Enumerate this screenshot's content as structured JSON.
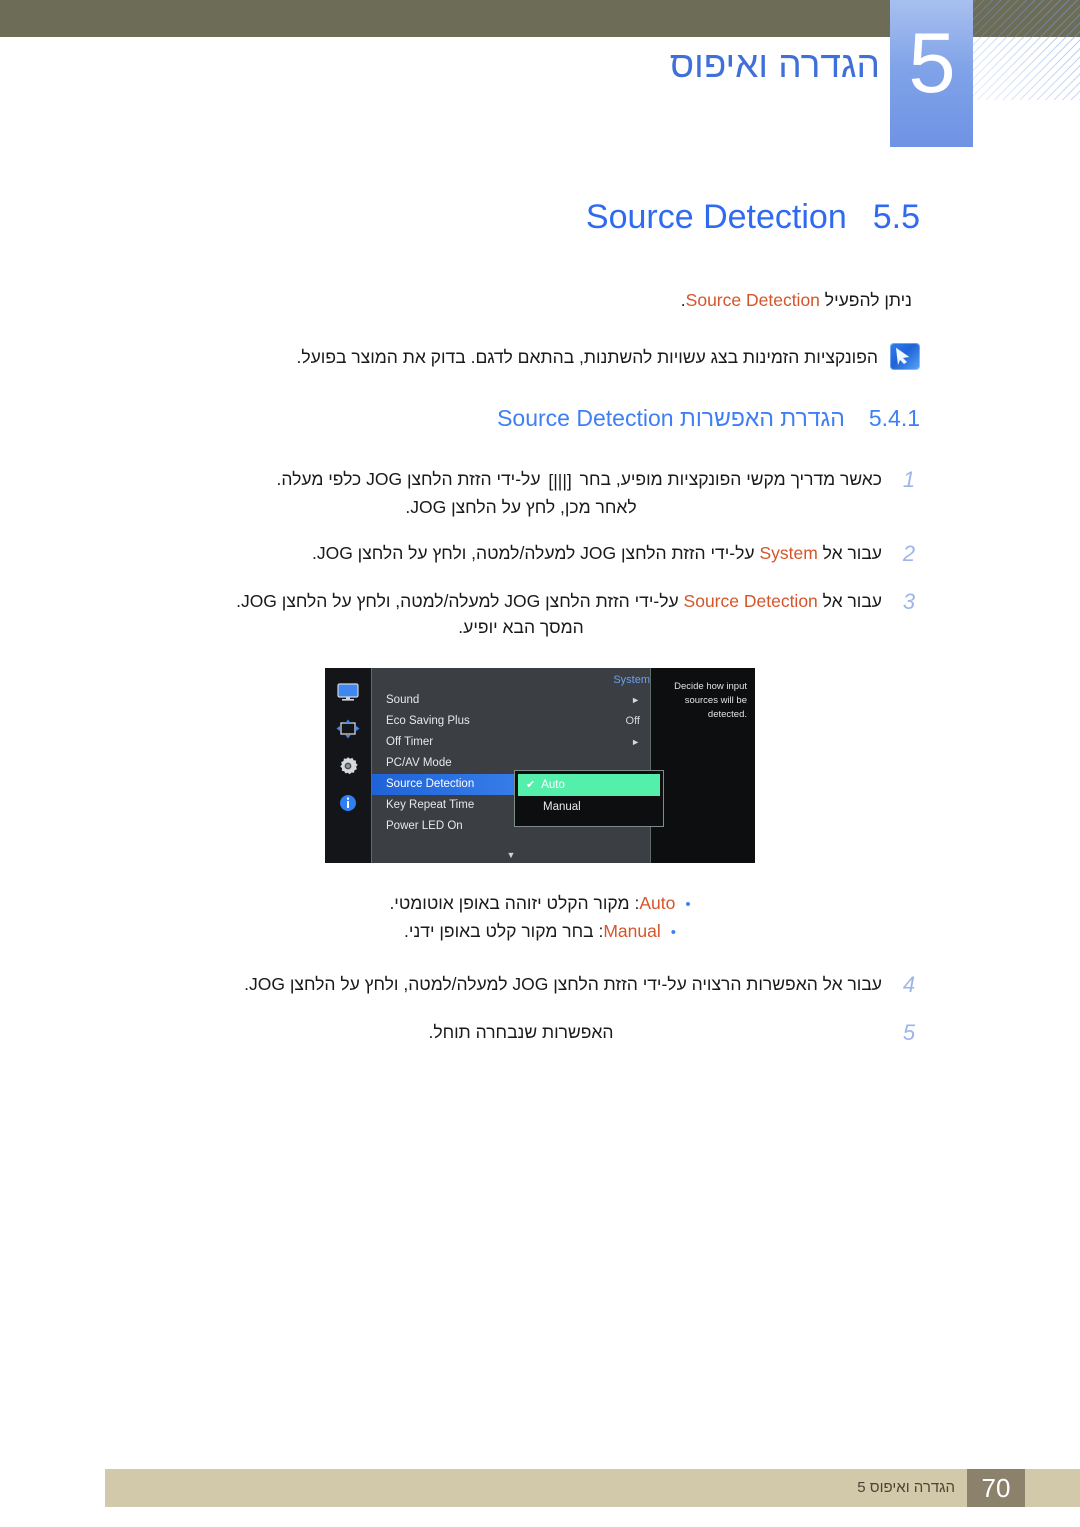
{
  "header": {
    "chapter_number": "5",
    "chapter_title": "הגדרה ואיפוס"
  },
  "section": {
    "number": "5.5",
    "title": "Source Detection",
    "lead_prefix": "ניתן להפעיל",
    "lead_term": "Source Detection",
    "lead_suffix": "."
  },
  "note": {
    "icon": "note-pen-icon",
    "text": "הפונקציות הזמינות בצג עשויות להשתנות, בהתאם לדגם. בדוק את המוצר בפועל."
  },
  "subsection": {
    "number": "5.4.1",
    "title_he": "הגדרת האפשרות",
    "title_en": "Source Detection"
  },
  "steps": [
    {
      "num": "1",
      "part_a": "כאשר מדריך מקשי הפונקציות מופיע, בחר",
      "glyph": "[|||]",
      "part_b": "על-ידי הזזת הלחצן JOG כלפי מעלה.",
      "line2": "לאחר מכן, לחץ על הלחצן JOG."
    },
    {
      "num": "2",
      "part_a": "עבור אל",
      "term": "System",
      "part_b": "על-ידי הזזת הלחצן JOG למעלה/למטה, ולחץ על הלחצן JOG.",
      "line2": ""
    },
    {
      "num": "3",
      "part_a": "עבור אל",
      "term": "Source Detection",
      "part_b": "על-ידי הזזת הלחצן JOG למעלה/למטה, ולחץ על הלחצן JOG.",
      "line2": "המסך הבא יופיע."
    },
    {
      "num": "4",
      "part_a": "עבור אל האפשרות הרצויה על-ידי הזזת הלחצן JOG למעלה/למטה, ולחץ על הלחצן JOG.",
      "term": "",
      "part_b": "",
      "line2": ""
    },
    {
      "num": "5",
      "part_a": "האפשרות שנבחרה תוחל.",
      "term": "",
      "part_b": "",
      "line2": ""
    }
  ],
  "osd": {
    "menu_title": "System",
    "sidebar_icons": [
      "monitor-icon",
      "picture-size-icon",
      "gear-icon",
      "info-icon"
    ],
    "items": [
      {
        "label": "Sound",
        "value": "",
        "arrow": "►",
        "selected": false
      },
      {
        "label": "Eco Saving Plus",
        "value": "Off",
        "arrow": "",
        "selected": false
      },
      {
        "label": "Off Timer",
        "value": "",
        "arrow": "►",
        "selected": false
      },
      {
        "label": "PC/AV Mode",
        "value": "",
        "arrow": "",
        "selected": false
      },
      {
        "label": "Source Detection",
        "value": "",
        "arrow": "",
        "selected": true
      },
      {
        "label": "Key Repeat Time",
        "value": "",
        "arrow": "",
        "selected": false
      },
      {
        "label": "Power LED On",
        "value": "",
        "arrow": "",
        "selected": false
      }
    ],
    "scroll_indicator": "▼",
    "submenu": [
      {
        "label": "Auto",
        "active": true,
        "check": "✔"
      },
      {
        "label": "Manual",
        "active": false,
        "check": ""
      }
    ],
    "description": "Decide how input sources will be detected."
  },
  "bullets": [
    {
      "term": "Auto",
      "text": ": מקור הקלט יזוהה באופן אוטומטי."
    },
    {
      "term": "Manual",
      "text": ": בחר מקור קלט באופן ידני."
    }
  ],
  "footer": {
    "chapter_label": "הגדרה ואיפוס 5",
    "page_number": "70"
  },
  "colors": {
    "accent_blue": "#2f6bf0",
    "term_orange": "#d4552a",
    "header_olive": "#6d6c56",
    "footer_tan": "#d2c8aa",
    "footer_page_box": "#8c826b",
    "osd_selected": "#3e86ef",
    "osd_active_green": "#55efac"
  }
}
